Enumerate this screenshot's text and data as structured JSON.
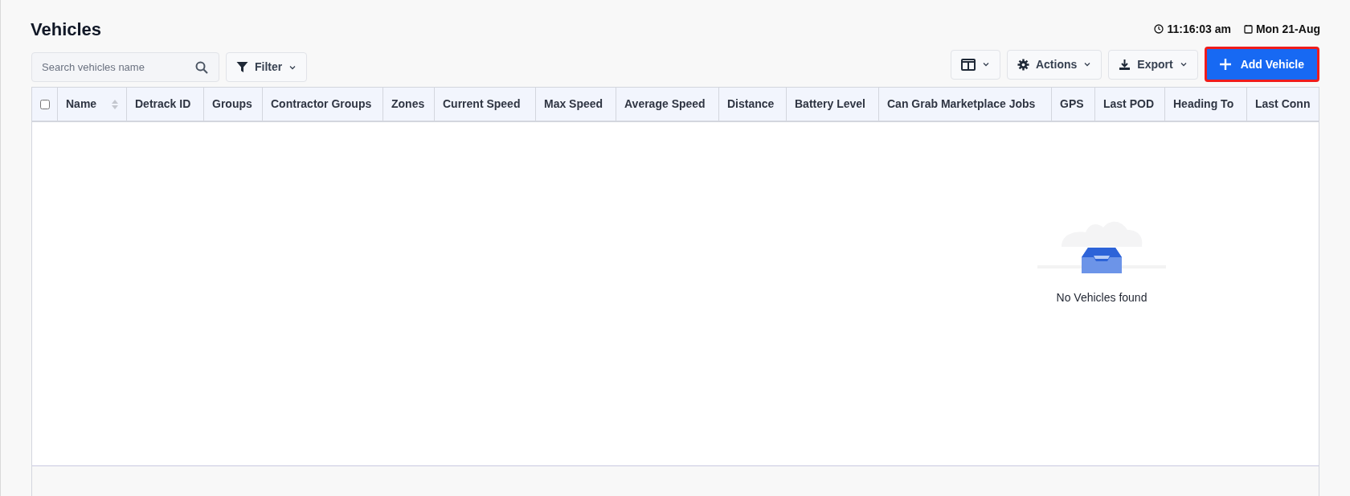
{
  "page": {
    "title": "Vehicles",
    "time": "11:16:03 am",
    "date": "Mon 21-Aug"
  },
  "toolbar": {
    "search": {
      "placeholder": "Search vehicles name"
    },
    "filter": "Filter",
    "actions": "Actions",
    "export": "Export",
    "add": {
      "label": "Add Vehicle",
      "highlighted": true
    }
  },
  "table": {
    "select_all": {
      "checked": false
    },
    "columns": [
      {
        "label": "Name",
        "sortable": true
      },
      {
        "label": "Detrack ID",
        "sortable": false
      },
      {
        "label": "Groups",
        "sortable": false
      },
      {
        "label": "Contractor Groups",
        "sortable": false
      },
      {
        "label": "Zones",
        "sortable": false
      },
      {
        "label": "Current Speed",
        "sortable": false
      },
      {
        "label": "Max Speed",
        "sortable": false
      },
      {
        "label": "Average Speed",
        "sortable": false
      },
      {
        "label": "Distance",
        "sortable": false
      },
      {
        "label": "Battery Level",
        "sortable": false
      },
      {
        "label": "Can Grab Marketplace Jobs",
        "sortable": false
      },
      {
        "label": "GPS",
        "sortable": false
      },
      {
        "label": "Last POD",
        "sortable": false
      },
      {
        "label": "Heading To",
        "sortable": false
      },
      {
        "label": "Last Conn",
        "sortable": false
      }
    ],
    "empty_message": "No Vehicles found"
  }
}
